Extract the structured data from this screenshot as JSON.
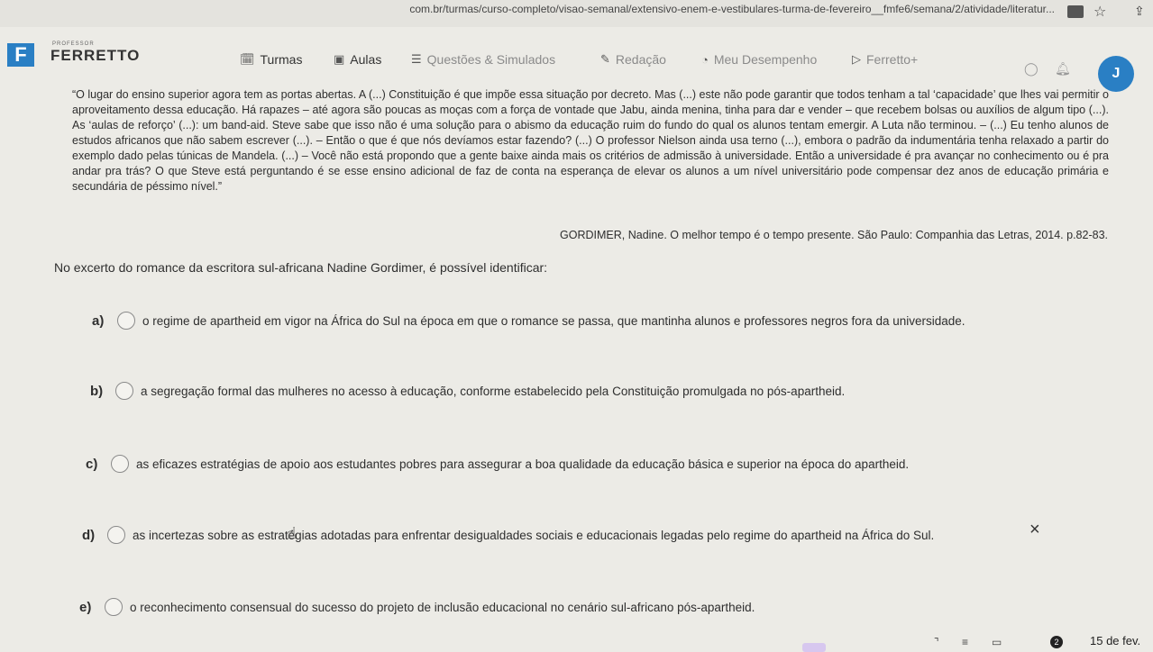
{
  "browser": {
    "url": "com.br/turmas/curso-completo/visao-semanal/extensivo-enem-e-vestibulares-turma-de-fevereiro__fmfe6/semana/2/atividade/literatur..."
  },
  "header": {
    "logo_letter": "F",
    "logo_tagline": "PROFESSOR",
    "logo_name": "FERRETTO",
    "nav": [
      {
        "label": "Turmas",
        "icon": "calendar-check-icon"
      },
      {
        "label": "Aulas",
        "icon": "play-icon"
      },
      {
        "label": "Questões & Simulados",
        "icon": "list-icon"
      },
      {
        "label": "Redação",
        "icon": "pencil-icon"
      },
      {
        "label": "Meu Desempenho",
        "icon": "chart-icon"
      },
      {
        "label": "Ferretto+",
        "icon": "play-box-icon"
      }
    ],
    "avatar_letter": "J"
  },
  "passage": {
    "text": "“O lugar do ensino superior agora tem as portas abertas. A (...) Constituição é que impõe essa situação por decreto. Mas (...) este não pode garantir que todos tenham a tal ‘capacidade’ que lhes vai permitir o aproveitamento dessa educação. Há rapazes – até agora são poucas as moças com a força de vontade que Jabu, ainda menina, tinha para dar e vender – que recebem bolsas ou auxílios de algum tipo (...). As ‘aulas de reforço’ (...): um band-aid. Steve sabe que isso não é uma solução para o abismo da educação ruim do fundo do qual os alunos tentam emergir. A Luta não terminou. – (...) Eu tenho alunos de estudos africanos que não sabem escrever (...). – Então o que é que nós devíamos estar fazendo? (...) O professor Nielson ainda usa terno (...), embora o padrão da indumentária tenha relaxado a partir do exemplo dado pelas túnicas de Mandela. (...) – Você não está propondo que a gente baixe ainda mais os critérios de admissão à universidade. Então a universidade é pra avançar no conhecimento ou é pra andar pra trás? O que Steve está perguntando é se esse ensino adicional de faz de conta na esperança de elevar os alunos a um nível universitário pode compensar dez anos de educação primária e secundária de péssimo nível.”",
    "citation": "GORDIMER, Nadine. O melhor tempo é o tempo presente. São Paulo: Companhia das Letras, 2014. p.82-83."
  },
  "question": "No excerto do romance da escritora sul-africana Nadine Gordimer, é possível identificar:",
  "options": [
    {
      "letter": "a)",
      "text": "o regime de apartheid em vigor na África do Sul na época em que o romance se passa, que mantinha alunos e professores negros fora da universidade."
    },
    {
      "letter": "b)",
      "text": "a segregação formal das mulheres no acesso à educação, conforme estabelecido pela Constituição promulgada no pós-apartheid."
    },
    {
      "letter": "c)",
      "text": "as eficazes estratégias de apoio aos estudantes pobres para assegurar a boa qualidade da educação básica e superior na época do apartheid."
    },
    {
      "letter": "d)",
      "text": "as incertezas sobre as estratégias adotadas para enfrentar desigualdades sociais e educacionais legadas pelo regime do apartheid na África do Sul."
    },
    {
      "letter": "e)",
      "text": "o reconhecimento consensual do sucesso do projeto de inclusão educacional no cenário sul-africano pós-apartheid."
    }
  ],
  "eliminate_mark": "×",
  "taskbar": {
    "badge": "2",
    "date": "15 de fev."
  }
}
